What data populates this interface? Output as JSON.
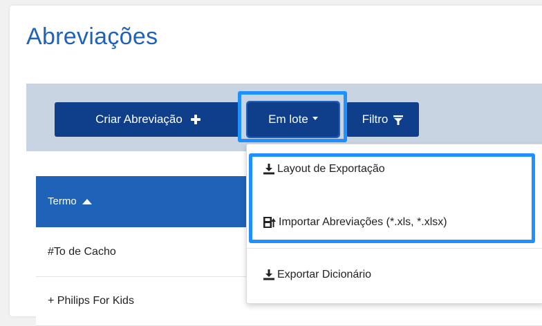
{
  "page": {
    "title": "Abreviações"
  },
  "toolbar": {
    "create_label": "Criar Abreviação",
    "batch_label": "Em lote",
    "filter_label": "Filtro"
  },
  "table": {
    "columns": [
      "Termo"
    ],
    "rows": [
      {
        "term": "#To de Cacho"
      },
      {
        "term": "+ Philips For Kids"
      }
    ]
  },
  "dropdown": {
    "items": [
      {
        "label": "Layout de Exportação",
        "icon": "download-icon"
      },
      {
        "label": "Importar Abreviações (*.xls, *.xlsx)",
        "icon": "import-file-icon"
      },
      {
        "label": "Exportar Dicionário",
        "icon": "download-icon"
      }
    ]
  },
  "colors": {
    "primary": "#1f63b9",
    "button": "#0f3f8b",
    "toolbar_bg": "#c9d4e2",
    "highlight": "#1e90ff"
  }
}
